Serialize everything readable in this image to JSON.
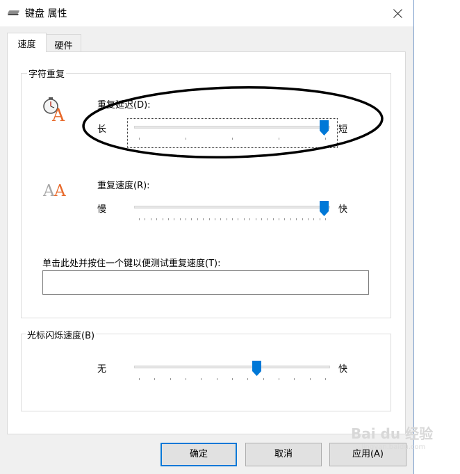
{
  "window": {
    "title": "键盘 属性"
  },
  "tabs": [
    {
      "label": "速度",
      "active": true
    },
    {
      "label": "硬件",
      "active": false
    }
  ],
  "repeat_group": {
    "title": "字符重复",
    "delay": {
      "label": "重复延迟(D):",
      "left": "长",
      "right": "短",
      "value_fraction": 1.0,
      "steps": 4
    },
    "rate": {
      "label": "重复速度(R):",
      "left": "慢",
      "right": "快",
      "value_fraction": 1.0,
      "steps": 32
    },
    "test": {
      "label": "单击此处并按住一个键以便测试重复速度(T):",
      "value": ""
    }
  },
  "blink_group": {
    "title": "光标闪烁速度(B)",
    "left": "无",
    "right": "快",
    "value_fraction": 0.64,
    "steps": 12
  },
  "buttons": {
    "ok": "确定",
    "cancel": "取消",
    "apply": "应用(A)"
  },
  "watermark": {
    "text": "Bai du 经验",
    "sub": "jingyan.baidu.com"
  },
  "colors": {
    "accent": "#0078d7",
    "annotation": "#000000"
  }
}
